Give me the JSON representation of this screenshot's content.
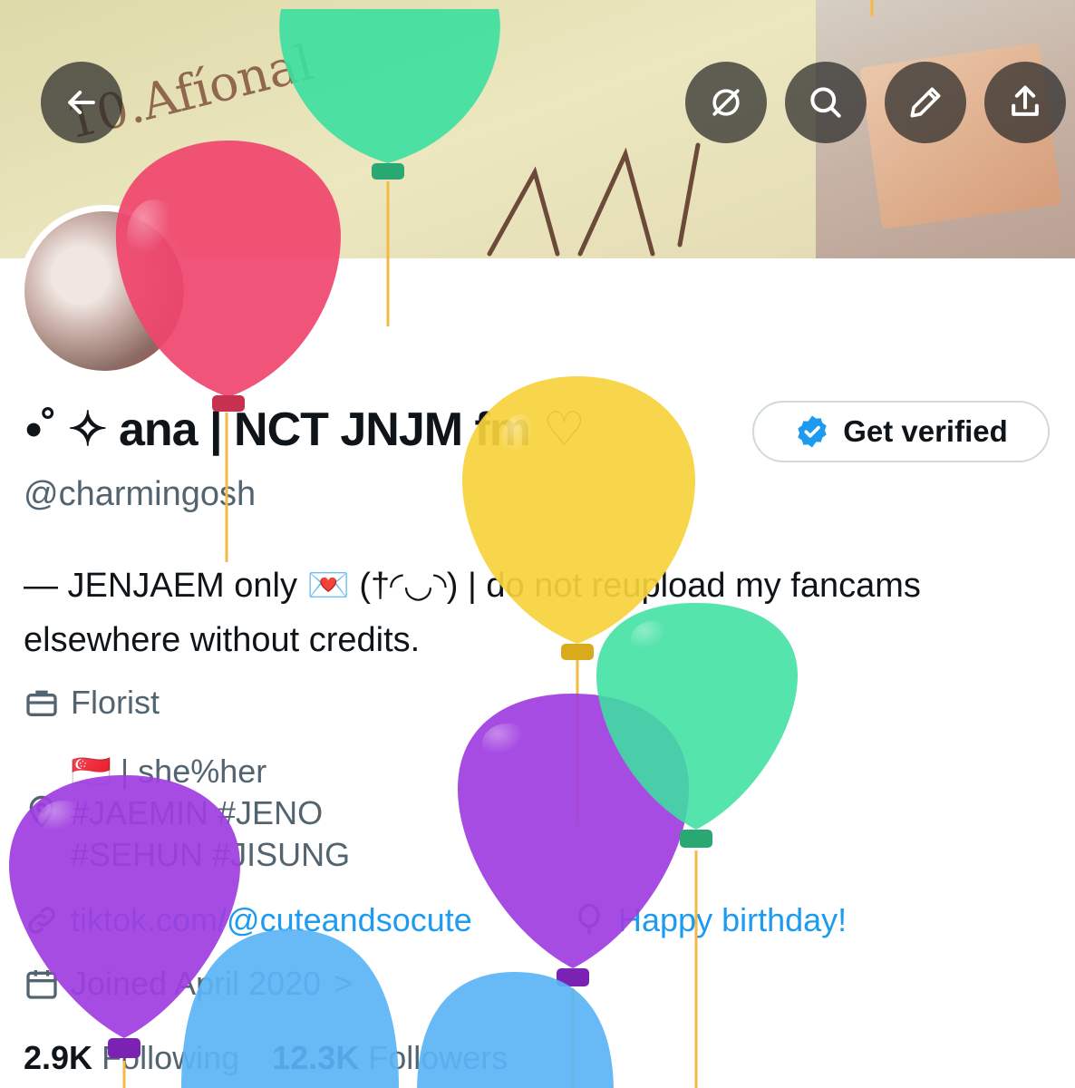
{
  "header": {
    "back_icon": "arrow-left-icon",
    "actions": [
      "circle-slash-icon",
      "search-icon",
      "pen-icon",
      "share-icon"
    ]
  },
  "banner": {
    "scribble": "10.Afíonal"
  },
  "profile": {
    "name": "•˚ ✧ ana | NCT JNJM fm",
    "name_suffix": "♡",
    "verify_label": "Get verified",
    "handle": "@charmingosh",
    "bio_line1": "— JENJAEM only 💌 (†◜◡◝) | do not reupload my fancams",
    "bio_line2": "elsewhere without credits.",
    "profession": "Florist",
    "location_line1": "🇸🇬 | she%her",
    "location_line2": "#JAEMIN #JENO",
    "location_line3": "#SEHUN #JISUNG",
    "website": "tiktok.com/@cuteandsocute",
    "birthday": "Happy birthday!",
    "joined": "Joined April 2020",
    "joined_chevron": ">",
    "following_count": "2.9K",
    "following_label": "Following",
    "followers_count": "12.3K",
    "followers_label": "Followers"
  },
  "colors": {
    "accent": "#1d9bf0",
    "secondary_text": "#536471",
    "balloon_pink": "#f0456e",
    "balloon_green": "#3ee0a0",
    "balloon_yellow": "#f7d23c",
    "balloon_purple": "#a03de0",
    "balloon_blue": "#5ab4f5"
  }
}
